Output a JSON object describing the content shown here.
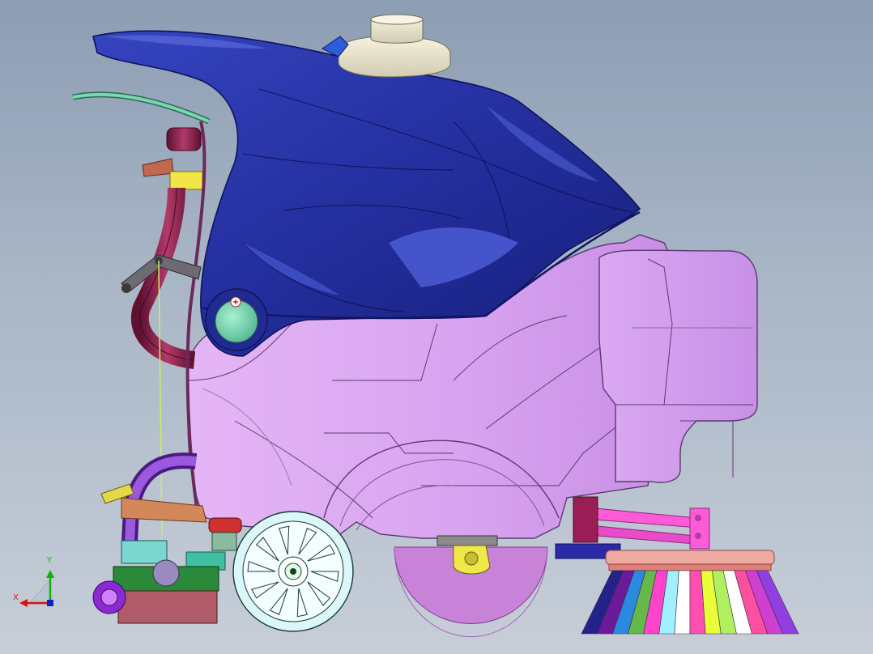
{
  "viewport": {
    "background_top": "#8d9db3",
    "background_bottom": "#c7ced8"
  },
  "model": {
    "colors": {
      "hood": "#232e9c",
      "hood_highlight": "#4f5fd8",
      "body": "#d7a2ef",
      "body_shade": "#b97fd4",
      "wheel": "#dcf7f8",
      "squeegee_disc": "#c883d8",
      "tank_cap": "#ece6cf",
      "hose": "#8a1e46",
      "drain_hose": "#7a3cc0",
      "knob": "#7ad8b0"
    },
    "brush_colors": [
      "#22228a",
      "#6a1a9a",
      "#2b8adf",
      "#66b84a",
      "#ff44cc",
      "#a0f0ff",
      "#ffffff",
      "#ff4fb0",
      "#e8ff3a",
      "#b0f060",
      "#ffffff",
      "#ff4fa0",
      "#d040d0",
      "#9040e0"
    ]
  },
  "triad": {
    "x_label": "X",
    "y_label": "Y",
    "x_color": "#e01010",
    "y_color": "#10b010",
    "z_color": "#1020d0"
  }
}
